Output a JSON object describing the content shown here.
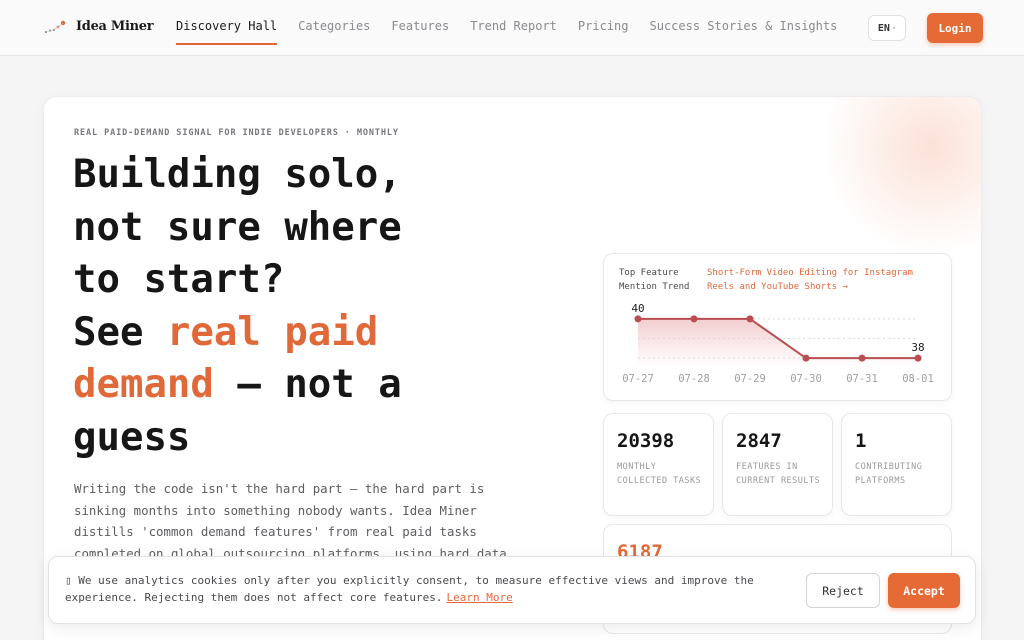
{
  "nav": {
    "brand": "Idea Miner",
    "links": [
      "Discovery Hall",
      "Categories",
      "Features",
      "Trend Report",
      "Pricing",
      "Success Stories & Insights"
    ],
    "active_index": 0,
    "lang": "EN",
    "login": "Login"
  },
  "hero": {
    "eyebrow": "REAL PAID-DEMAND SIGNAL FOR INDIE DEVELOPERS · MONTHLY",
    "headline_line1": "Building solo,",
    "headline_line2": "not sure where",
    "headline_line3": "to start?",
    "headline_see": "See ",
    "headline_accent": "real paid demand",
    "headline_tail": " — not a guess",
    "description": "Writing the code isn't the hard part — the hard part is sinking months into something nobody wants. Idea Miner distills 'common demand features' from real paid tasks completed on global outsourcing platforms, using hard data"
  },
  "trend_card": {
    "title": "Top Feature Mention Trend",
    "link": "Short-Form Video Editing for Instagram Reels and YouTube Shorts →"
  },
  "chart_data": {
    "type": "line",
    "x": [
      "07-27",
      "07-28",
      "07-29",
      "07-30",
      "07-31",
      "08-01"
    ],
    "series": [
      {
        "values": [
          40,
          40,
          40,
          38,
          38,
          38
        ]
      }
    ],
    "data_labels": [
      "40",
      "38"
    ],
    "ylim": [
      37.6,
      40.4
    ],
    "grid": true,
    "line_color": "#b94d52",
    "fill_color": "#f2c9cb"
  },
  "stats": [
    {
      "value": "20398",
      "label": "MONTHLY COLLECTED TASKS"
    },
    {
      "value": "2847",
      "label": "FEATURES IN CURRENT RESULTS"
    },
    {
      "value": "1",
      "label": "CONTRIBUTING PLATFORMS"
    }
  ],
  "stat_wide": {
    "value": "6187"
  },
  "cookie": {
    "text": "We use analytics cookies only after you explicitly consent, to measure effective views and improve the experience. Rejecting them does not affect core features.",
    "link": "Learn More",
    "reject": "Reject",
    "accept": "Accept"
  },
  "colors": {
    "accent": "#e0693a",
    "button": "#e56a35",
    "chart_line": "#b94d52"
  }
}
